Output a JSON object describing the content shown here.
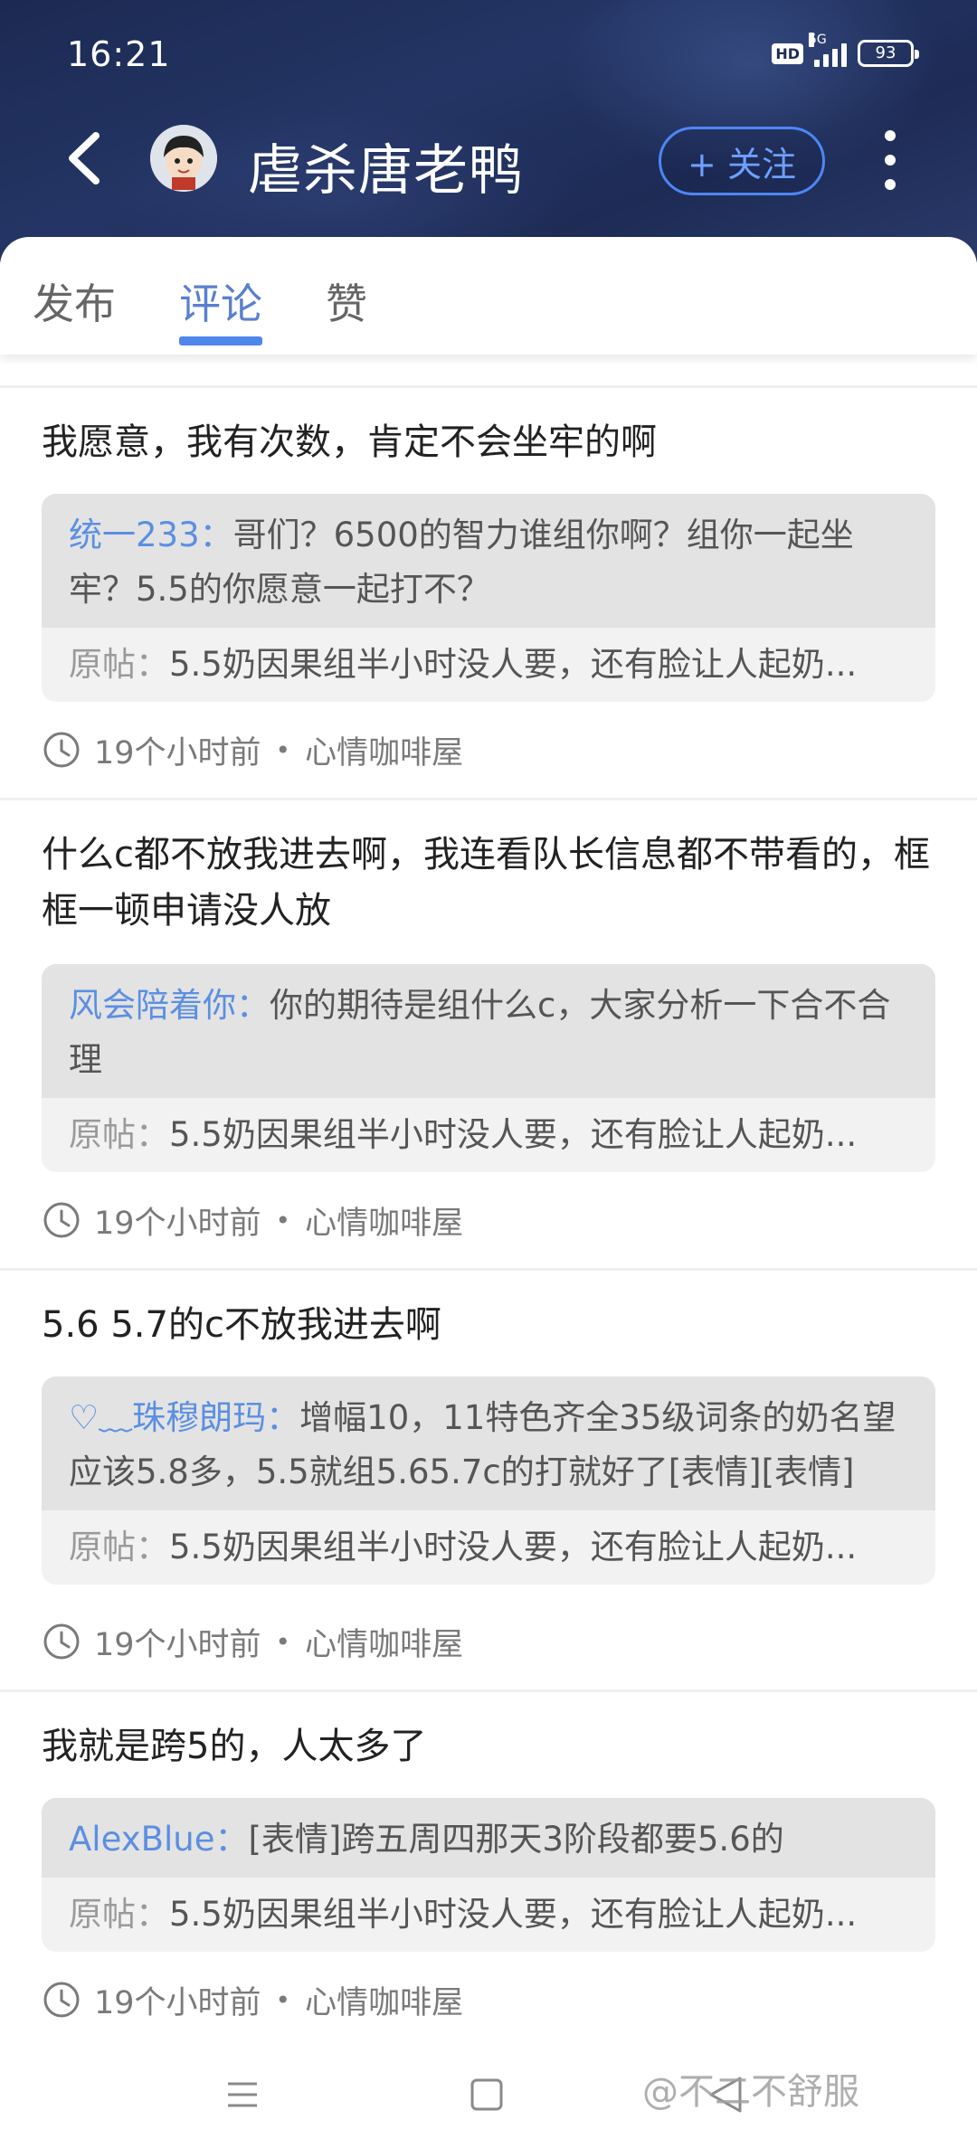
{
  "status_bar": {
    "time": "16:21",
    "hd": "HD",
    "network": "5G",
    "battery": "93"
  },
  "header": {
    "username": "虐杀唐老鸭",
    "follow_label": "+ 关注",
    "icons": [
      "back-icon",
      "avatar",
      "more-icon"
    ]
  },
  "tabs": [
    {
      "label": "发布"
    },
    {
      "label": "评论"
    },
    {
      "label": "赞"
    }
  ],
  "comments": [
    {
      "text": "我愿意，我有次数，肯定不会坐牢的啊",
      "quote_author": "统一233：",
      "quote_text": "哥们？6500的智力谁组你啊？组你一起坐牢？5.5的你愿意一起打不？",
      "orig_label": "原帖：",
      "orig_text": "5.5奶因果组半小时没人要，还有脸让人起奶...",
      "time": "19个小时前",
      "forum": "心情咖啡屋"
    },
    {
      "text": "什么c都不放我进去啊，我连看队长信息都不带看的，框框一顿申请没人放",
      "quote_author": "风会陪着你：",
      "quote_text": "你的期待是组什么c，大家分析一下合不合理",
      "orig_label": "原帖：",
      "orig_text": "5.5奶因果组半小时没人要，还有脸让人起奶...",
      "time": "19个小时前",
      "forum": "心情咖啡屋"
    },
    {
      "text": "5.6 5.7的c不放我进去啊",
      "quote_author": "♡﹏珠穆朗玛：",
      "quote_text": "增幅10，11特色齐全35级词条的奶名望应该5.8多，5.5就组5.65.7c的打就好了[表情][表情]",
      "orig_label": "原帖：",
      "orig_text": "5.5奶因果组半小时没人要，还有脸让人起奶...",
      "time": "19个小时前",
      "forum": "心情咖啡屋"
    },
    {
      "text": "我就是跨5的，人太多了",
      "quote_author": "AlexBlue：",
      "quote_text": "[表情]跨五周四那天3阶段都要5.6的",
      "orig_label": "原帖：",
      "orig_text": "5.5奶因果组半小时没人要，还有脸让人起奶...",
      "time": "19个小时前",
      "forum": "心情咖啡屋"
    }
  ],
  "nav_bar": [
    "menu-icon",
    "home-icon",
    "back-icon"
  ],
  "watermark": "@不二不舒服"
}
